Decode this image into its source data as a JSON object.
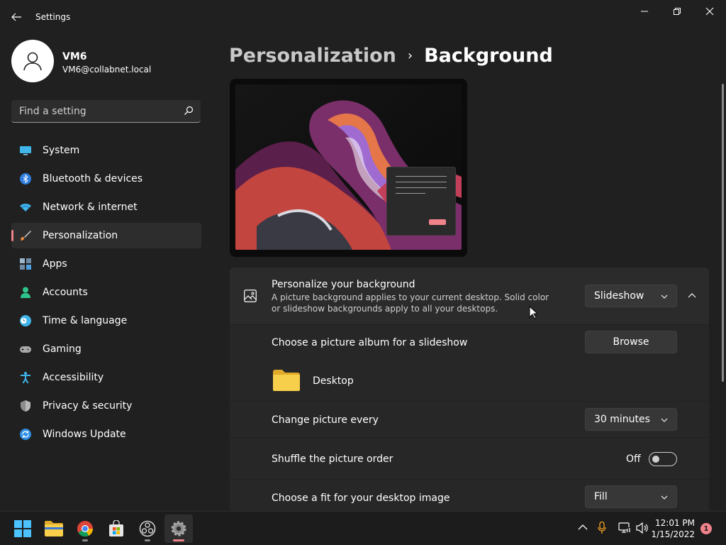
{
  "window": {
    "title": "Settings"
  },
  "user": {
    "name": "VM6",
    "email": "VM6@collabnet.local"
  },
  "search": {
    "placeholder": "Find a setting"
  },
  "nav": [
    {
      "label": "System",
      "icon": "monitor-icon"
    },
    {
      "label": "Bluetooth & devices",
      "icon": "bluetooth-icon"
    },
    {
      "label": "Network & internet",
      "icon": "wifi-icon"
    },
    {
      "label": "Personalization",
      "icon": "brush-icon",
      "active": true
    },
    {
      "label": "Apps",
      "icon": "apps-icon"
    },
    {
      "label": "Accounts",
      "icon": "person-icon"
    },
    {
      "label": "Time & language",
      "icon": "clock-globe-icon"
    },
    {
      "label": "Gaming",
      "icon": "gamepad-icon"
    },
    {
      "label": "Accessibility",
      "icon": "accessibility-icon"
    },
    {
      "label": "Privacy & security",
      "icon": "shield-icon"
    },
    {
      "label": "Windows Update",
      "icon": "update-icon"
    }
  ],
  "breadcrumb": {
    "parent": "Personalization",
    "separator": "›",
    "current": "Background"
  },
  "background_card": {
    "title": "Personalize your background",
    "description": "A picture background applies to your current desktop. Solid color or slideshow backgrounds apply to all your desktops.",
    "value": "Slideshow"
  },
  "album": {
    "label": "Choose a picture album for a slideshow",
    "button": "Browse",
    "folder": "Desktop"
  },
  "change_every": {
    "label": "Change picture every",
    "value": "30 minutes"
  },
  "shuffle": {
    "label": "Shuffle the picture order",
    "state": "Off"
  },
  "fit": {
    "label": "Choose a fit for your desktop image",
    "value": "Fill"
  },
  "taskbar": {
    "time": "12:01 PM",
    "date": "1/15/2022",
    "notification_count": "1"
  },
  "colors": {
    "accent": "#f0828a",
    "background": "#202020",
    "card": "#2b2b2b"
  }
}
